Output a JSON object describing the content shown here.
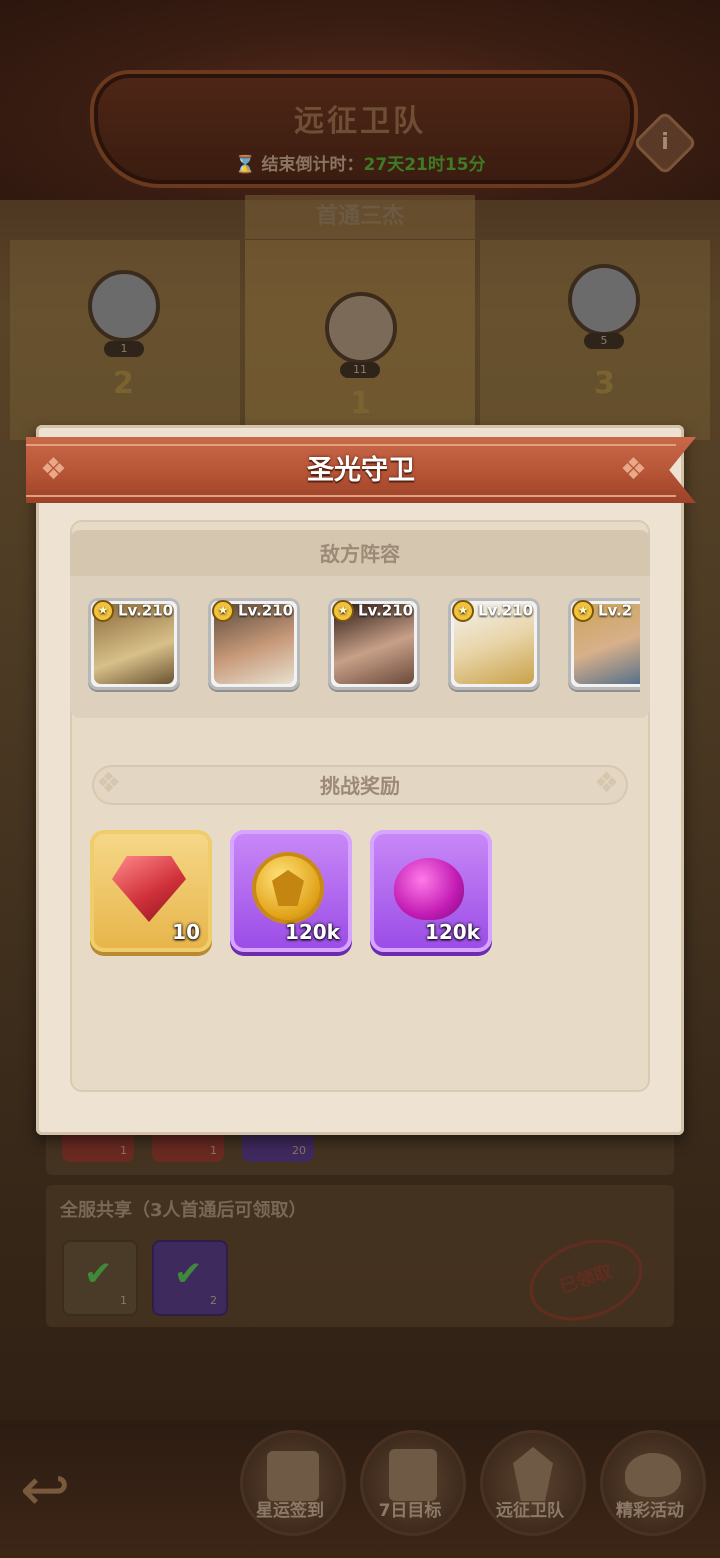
{
  "background": {
    "title": "远征卫队",
    "countdown_label": "结束倒计时：",
    "countdown_value": "27天21时15分",
    "info_icon": "i",
    "subtitle": "首通三杰",
    "podium": [
      {
        "rank": "2",
        "level": "1"
      },
      {
        "rank": "1",
        "level": "11"
      },
      {
        "rank": "3",
        "level": "5"
      }
    ],
    "slot_counts_row1": [
      "1",
      "1",
      "20"
    ],
    "share_label": "全服共享（3人首通后可领取）",
    "share_slot_counts": [
      "1",
      "2"
    ],
    "claimed_stamp": "已领取"
  },
  "nav": {
    "items": [
      {
        "label": "星运签到",
        "icon": "calendar-icon"
      },
      {
        "label": "7日目标",
        "icon": "checklist-icon"
      },
      {
        "label": "远征卫队",
        "icon": "guard-emblem-icon"
      },
      {
        "label": "精彩活动",
        "icon": "horn-icon"
      }
    ]
  },
  "modal": {
    "title": "圣光守卫",
    "lineup_title": "敌方阵容",
    "heroes": [
      {
        "level": "Lv.210",
        "color": "#c9b58a"
      },
      {
        "level": "Lv.210",
        "color": "#b48a6a"
      },
      {
        "level": "Lv.210",
        "color": "#7a5a4a"
      },
      {
        "level": "Lv.210",
        "color": "#d9c9a6"
      },
      {
        "level": "Lv.2",
        "color": "#b09a6a"
      }
    ],
    "reward_title": "挑战奖励",
    "rewards": [
      {
        "name": "ruby-gem",
        "qty": "10",
        "style": "gold"
      },
      {
        "name": "gold-coin",
        "qty": "120k",
        "style": "purple"
      },
      {
        "name": "purple-essence",
        "qty": "120k",
        "style": "purple"
      }
    ]
  },
  "colors": {
    "ribbon": "#b65436",
    "countdown_green": "#3f7a25",
    "rarity_gold": "#e7b449",
    "rarity_purple": "#9a4be6"
  }
}
